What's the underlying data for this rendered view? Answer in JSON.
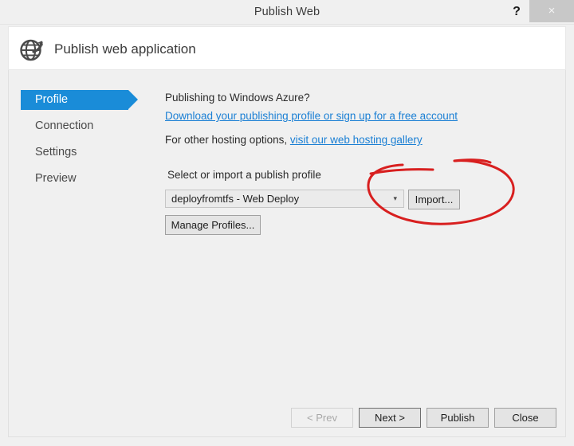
{
  "window": {
    "title": "Publish Web",
    "help_label": "?",
    "close_label": "×"
  },
  "header": {
    "title": "Publish web application",
    "icon": "globe-publish-icon"
  },
  "sidebar": {
    "items": [
      {
        "label": "Profile",
        "selected": true
      },
      {
        "label": "Connection",
        "selected": false
      },
      {
        "label": "Settings",
        "selected": false
      },
      {
        "label": "Preview",
        "selected": false
      }
    ]
  },
  "content": {
    "azure_question": "Publishing to Windows Azure?",
    "azure_link": "Download your publishing profile or sign up for a free account",
    "hosting_prefix": "For other hosting options, ",
    "hosting_link": "visit our web hosting gallery",
    "select_label": "Select or import a publish profile",
    "profile_select": {
      "value": "deployfromtfs - Web Deploy",
      "arrow_icon": "chevron-down-icon",
      "options": [
        "deployfromtfs - Web Deploy"
      ]
    },
    "import_label": "Import...",
    "manage_label": "Manage Profiles..."
  },
  "footer": {
    "prev_label": "< Prev",
    "next_label": "Next >",
    "publish_label": "Publish",
    "close_label": "Close"
  },
  "annotation": {
    "type": "hand-drawn-ellipse",
    "color": "#d81f1f",
    "target": "Import button"
  },
  "colors": {
    "accent_blue": "#1a8cd8",
    "link_blue": "#1a7fd4",
    "annotation_red": "#d81f1f",
    "window_bg": "#f0f0f0"
  }
}
